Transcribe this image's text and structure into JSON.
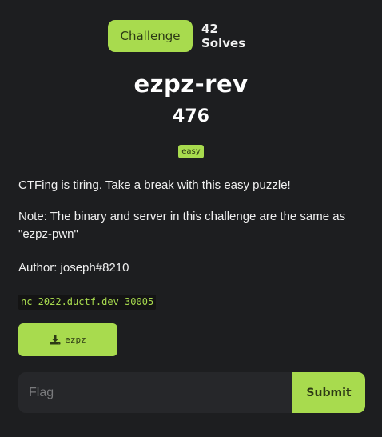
{
  "tabs": {
    "challenge_label": "Challenge",
    "solves_label": "42 Solves"
  },
  "challenge": {
    "name": "ezpz-rev",
    "points": "476",
    "difficulty": "easy",
    "description": [
      "CTFing is tiring. Take a break with this easy puzzle!",
      "Note: The binary and server in this challenge are the same as \"ezpz-pwn\"",
      "Author: joseph#8210"
    ],
    "connection": "nc 2022.ductf.dev 30005",
    "file": {
      "icon": "download-icon",
      "name": "ezpz"
    }
  },
  "form": {
    "flag_placeholder": "Flag",
    "flag_value": "",
    "submit_label": "Submit"
  },
  "colors": {
    "accent": "#a8db4e",
    "background": "#1d1e20",
    "input_bg": "#26272a"
  }
}
